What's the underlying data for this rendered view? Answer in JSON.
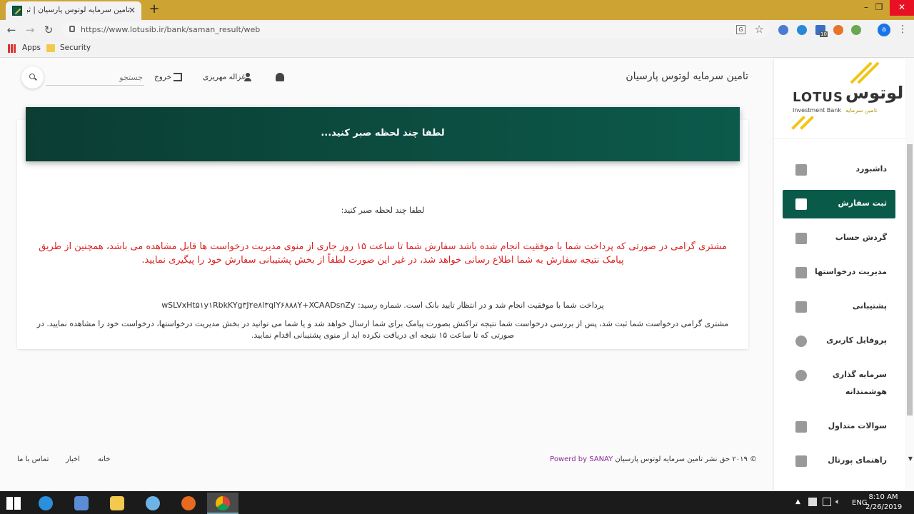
{
  "browser": {
    "tab_title": "تامین سرمایه لوتوس پارسیان | ثبت",
    "tab_close": "×",
    "new_tab": "+",
    "url": "https://www.lotusib.ir/bank/saman_result/web",
    "window_controls": {
      "minimize": "–",
      "restore": "❐",
      "close": "✕"
    },
    "profile_initial": "a",
    "bookmarks": [
      {
        "label": "Apps"
      },
      {
        "label": "Security"
      }
    ],
    "extension_badge": "10"
  },
  "sidebar": {
    "logo": {
      "en": "LOTUS",
      "fa": "لوتوس",
      "sub_en": "Investment Bank",
      "sub_fa": "تامین سرمایه"
    },
    "items": [
      {
        "label": "داشبورد",
        "icon": "dashboard-icon"
      },
      {
        "label": "ثبت سفارش",
        "icon": "cart-icon",
        "active": true
      },
      {
        "label": "گردش حساب",
        "icon": "clipboard-icon"
      },
      {
        "label": "مدیریت درخواستها",
        "icon": "list-icon"
      },
      {
        "label": "پشتیبانی",
        "icon": "support-icon"
      },
      {
        "label": "پروفایل کاربری",
        "icon": "user-icon"
      },
      {
        "label": "سرمایه گذاری",
        "label2": "هوشمندانه",
        "icon": "invest-icon"
      },
      {
        "label": "سوالات متداول",
        "icon": "help-icon"
      },
      {
        "label": "راهنمای پورتال",
        "icon": "bell-icon"
      }
    ]
  },
  "header": {
    "site_title": "تامین سرمایه لوتوس پارسیان",
    "username": "غزاله مهریزی",
    "logout": "خروج",
    "search_placeholder": "جستجو"
  },
  "card": {
    "title": "لطفا چند لحظه صبر کنید...",
    "wait": "لطفا چند لحظه صبر کنید:",
    "notice": "مشتری گرامی در صورتی که پرداخت شما با موفقیت انجام شده باشد سفارش شما تا ساعت ۱۵ روز جاری از منوی مدیریت درخواست ها قابل مشاهده می باشد، همچنین از طریق پیامک نتیجه سفارش به شما اطلاع رسانی خواهد شد، در غیر این صورت لطفاً از بخش پشتیبانی سفارش خود را پیگیری نمایید.",
    "paid": "پرداخت شما با موفقیت انجام شد و در انتظار تایید بانک است. شماره رسید: wSLVxHt۵۱y۱RbkKYg۳J۲e۸l۳qlY۶۸۸۸Y+XCAADsnZy",
    "info": "مشتری گرامی درخواست شما ثبت شد، پس از بررسی درخواست شما نتیجه تراکنش بصورت پیامک برای شما ارسال خواهد شد و یا شما می توانید در بخش مدیریت درخواستها، درخواست خود را مشاهده نمایید. در صورتی که تا ساعت ۱۵ نتیجه ای دریافت نکرده اید از منوی پشتیبانی اقدام نمایید."
  },
  "footer": {
    "copyright": "© ۲۰۱۹ حق نشر تامین سرمایه لوتوس پارسیان",
    "powered": "Powerd by SANAY",
    "links": [
      "خانه",
      "اخبار",
      "تماس با ما"
    ]
  },
  "taskbar": {
    "lang": "ENG",
    "time": "8:10 AM",
    "date": "2/26/2019"
  },
  "colors": {
    "accent": "#0a5a4a",
    "gold": "#f2c518",
    "notice_red": "#e02020",
    "sanay": "#8e2a9a"
  }
}
